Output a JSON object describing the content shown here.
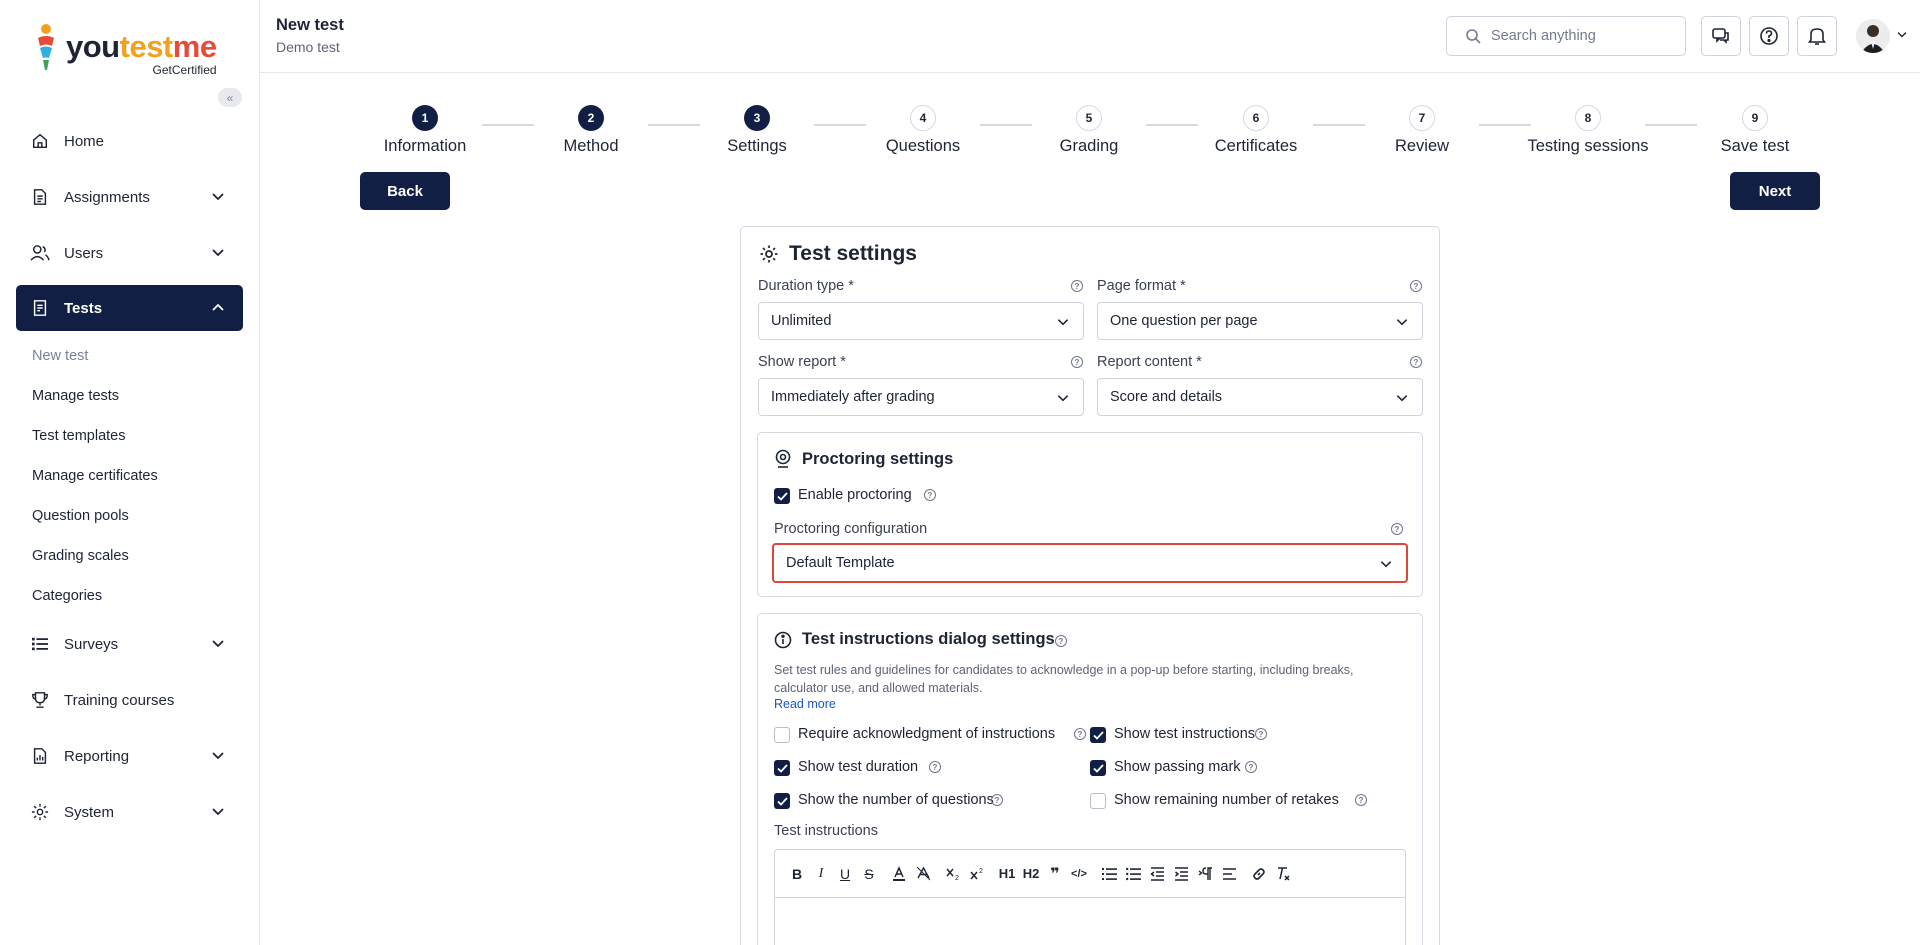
{
  "brand": {
    "name_a": "you",
    "name_b": "test",
    "name_c": "me",
    "sub": "GetCertified"
  },
  "sidebar": {
    "items": [
      {
        "label": "Home",
        "icon": "home-icon"
      },
      {
        "label": "Assignments",
        "icon": "assignment-icon"
      },
      {
        "label": "Users",
        "icon": "users-icon"
      },
      {
        "label": "Tests",
        "icon": "test-icon"
      },
      {
        "label": "Surveys",
        "icon": "list-icon"
      },
      {
        "label": "Training courses",
        "icon": "trophy-icon"
      },
      {
        "label": "Reporting",
        "icon": "report-icon"
      },
      {
        "label": "System",
        "icon": "gear-icon"
      }
    ],
    "tests_sub": [
      "New test",
      "Manage tests",
      "Test templates",
      "Manage certificates",
      "Question pools",
      "Grading scales",
      "Categories"
    ]
  },
  "header": {
    "title": "New test",
    "subtitle": "Demo test",
    "search_placeholder": "Search anything"
  },
  "stepper": {
    "steps": [
      {
        "num": "1",
        "label": "Information"
      },
      {
        "num": "2",
        "label": "Method"
      },
      {
        "num": "3",
        "label": "Settings"
      },
      {
        "num": "4",
        "label": "Questions"
      },
      {
        "num": "5",
        "label": "Grading"
      },
      {
        "num": "6",
        "label": "Certificates"
      },
      {
        "num": "7",
        "label": "Review"
      },
      {
        "num": "8",
        "label": "Testing sessions"
      },
      {
        "num": "9",
        "label": "Save test"
      }
    ],
    "back": "Back",
    "next": "Next"
  },
  "settings": {
    "title": "Test settings",
    "duration_type": {
      "label": "Duration type",
      "value": "Unlimited"
    },
    "page_format": {
      "label": "Page format",
      "value": "One question per page"
    },
    "show_report": {
      "label": "Show report",
      "value": "Immediately after grading"
    },
    "report_content": {
      "label": "Report content",
      "value": "Score and details"
    },
    "required_mark": "*"
  },
  "proctoring": {
    "title": "Proctoring settings",
    "enable_label": "Enable proctoring",
    "config_label": "Proctoring configuration",
    "config_value": "Default Template"
  },
  "instructions": {
    "title": "Test instructions dialog settings",
    "description": "Set test rules and guidelines for candidates to acknowledge in a pop-up before starting, including breaks, calculator use, and allowed materials.",
    "read_more": "Read more",
    "options": [
      {
        "label": "Require acknowledgment of instructions",
        "checked": false
      },
      {
        "label": "Show test instructions",
        "checked": true
      },
      {
        "label": "Show test duration",
        "checked": true
      },
      {
        "label": "Show passing mark",
        "checked": true
      },
      {
        "label": "Show the number of questions",
        "checked": true
      },
      {
        "label": "Show remaining number of retakes",
        "checked": false
      }
    ],
    "editor_label": "Test instructions",
    "toolbar": {
      "bold": "B",
      "italic": "I",
      "underline": "U",
      "strike": "S",
      "h1": "H1",
      "h2": "H2",
      "quote": "❞",
      "code": "</>"
    }
  },
  "colors": {
    "primary": "#121f45",
    "highlight": "#e0453b",
    "link": "#1a56c9"
  }
}
